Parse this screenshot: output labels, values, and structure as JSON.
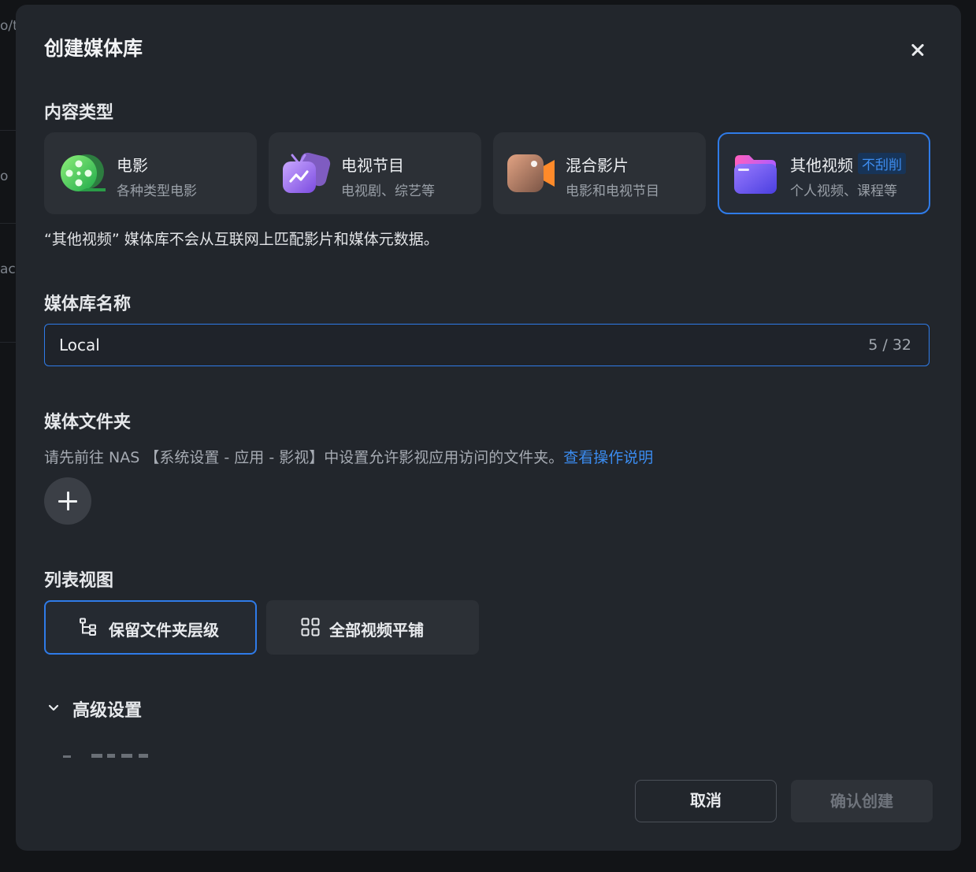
{
  "background": {
    "fragments": [
      "o/t",
      "o",
      "acc"
    ]
  },
  "dialog": {
    "title": "创建媒体库",
    "close_icon": "close-icon"
  },
  "content_type": {
    "label": "内容类型",
    "options": [
      {
        "name": "电影",
        "desc": "各种类型电影",
        "icon": "film-reel-icon",
        "selected": false
      },
      {
        "name": "电视节目",
        "desc": "电视剧、综艺等",
        "icon": "tv-icon",
        "selected": false
      },
      {
        "name": "混合影片",
        "desc": "电影和电视节目",
        "icon": "video-camera-icon",
        "selected": false
      },
      {
        "name": "其他视频",
        "desc": "个人视频、课程等",
        "icon": "folder-icon",
        "tag": "不刮削",
        "selected": true
      }
    ],
    "note": "“其他视频” 媒体库不会从互联网上匹配影片和媒体元数据。"
  },
  "library_name": {
    "label": "媒体库名称",
    "value": "Local",
    "counter": "5 / 32"
  },
  "media_folder": {
    "label": "媒体文件夹",
    "hint": "请先前往 NAS 【系统设置 - 应用 - 影视】中设置允许影视应用访问的文件夹。",
    "link": "查看操作说明",
    "add_icon": "plus-icon"
  },
  "list_view": {
    "label": "列表视图",
    "options": [
      {
        "label": "保留文件夹层级",
        "icon": "folder-tree-icon",
        "selected": true
      },
      {
        "label": "全部视频平铺",
        "icon": "grid-icon",
        "selected": false
      }
    ]
  },
  "advanced": {
    "label": "高级设置",
    "icon": "chevron-down-icon"
  },
  "footer": {
    "cancel": "取消",
    "confirm": "确认创建"
  },
  "colors": {
    "accent": "#2f7be8",
    "dialog_bg": "#22262c",
    "card_bg": "#2c3036",
    "link": "#3b8cf0"
  }
}
